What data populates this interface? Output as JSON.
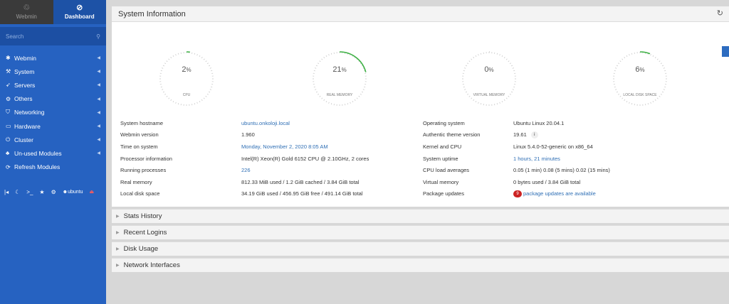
{
  "sidebar": {
    "tabs": {
      "webmin": "Webmin",
      "dashboard": "Dashboard"
    },
    "search_placeholder": "Search",
    "items": [
      {
        "label": "Webmin"
      },
      {
        "label": "System"
      },
      {
        "label": "Servers"
      },
      {
        "label": "Others"
      },
      {
        "label": "Networking"
      },
      {
        "label": "Hardware"
      },
      {
        "label": "Cluster"
      },
      {
        "label": "Un-used Modules"
      },
      {
        "label": "Refresh Modules"
      }
    ],
    "bottom": {
      "user": "ubuntu"
    }
  },
  "panel": {
    "title": "System Information"
  },
  "gauges": [
    {
      "value": "2",
      "unit": "%",
      "label": "CPU",
      "fraction": 0.02
    },
    {
      "value": "21",
      "unit": "%",
      "label": "REAL MEMORY",
      "fraction": 0.21
    },
    {
      "value": "0",
      "unit": "%",
      "label": "VIRTUAL MEMORY",
      "fraction": 0.0
    },
    {
      "value": "6",
      "unit": "%",
      "label": "LOCAL DISK SPACE",
      "fraction": 0.06
    }
  ],
  "info_left": [
    {
      "key": "System hostname",
      "value": "ubuntu.onkoloji.local",
      "link": true
    },
    {
      "key": "Webmin version",
      "value": "1.960",
      "link": false
    },
    {
      "key": "Time on system",
      "value": "Monday, November 2, 2020 8:05 AM",
      "link": true
    },
    {
      "key": "Processor information",
      "value": "Intel(R) Xeon(R) Gold 6152 CPU @ 2.10GHz, 2 cores",
      "link": false
    },
    {
      "key": "Running processes",
      "value": "226",
      "link": true
    },
    {
      "key": "Real memory",
      "value": "812.33 MiB used / 1.2 GiB cached / 3.84 GiB total",
      "link": false
    },
    {
      "key": "Local disk space",
      "value": "34.19 GiB used / 456.95 GiB free / 491.14 GiB total",
      "link": false
    }
  ],
  "info_right": [
    {
      "key": "Operating system",
      "value": "Ubuntu Linux 20.04.1",
      "link": false
    },
    {
      "key": "Authentic theme version",
      "value": "19.61",
      "link": false
    },
    {
      "key": "Kernel and CPU",
      "value": "Linux 5.4.0-52-generic on x86_64",
      "link": false
    },
    {
      "key": "System uptime",
      "value": "1 hours, 21 minutes",
      "link": true
    },
    {
      "key": "CPU load averages",
      "value": "0.05 (1 min) 0.08 (5 mins) 0.02 (15 mins)",
      "link": false
    },
    {
      "key": "Virtual memory",
      "value": "0 bytes used / 3.84 GiB total",
      "link": false
    },
    {
      "key": "Package updates",
      "value": "package updates are available",
      "link": true,
      "badge": "9"
    }
  ],
  "sections": [
    "Stats History",
    "Recent Logins",
    "Disk Usage",
    "Network Interfaces"
  ],
  "colors": {
    "sidebar": "#2662c1",
    "gauge_active": "#3cb043",
    "link": "#2f6fb5",
    "badge": "#cc2222"
  }
}
